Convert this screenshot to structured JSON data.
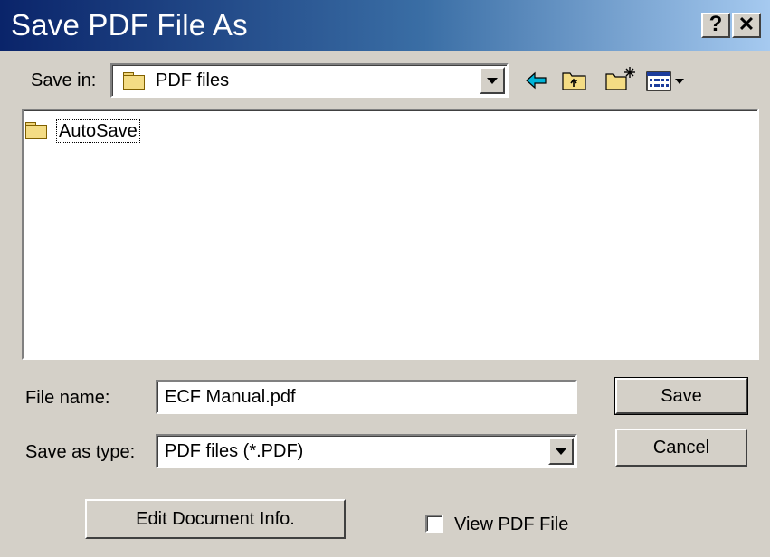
{
  "window": {
    "title": "Save PDF File As",
    "help_label": "?",
    "close_label": "✕"
  },
  "save_in": {
    "label": "Save in:",
    "value": "PDF files"
  },
  "toolbar": {
    "back_icon": "back-arrow-icon",
    "up_icon": "up-one-level-icon",
    "new_folder_icon": "new-folder-icon",
    "view_menu_icon": "view-menu-icon"
  },
  "file_list": {
    "items": [
      {
        "label": "AutoSave",
        "icon": "folder-icon"
      }
    ]
  },
  "file_name": {
    "label": "File name:",
    "value": "ECF Manual.pdf"
  },
  "save_as_type": {
    "label": "Save as type:",
    "value": "PDF files (*.PDF)"
  },
  "buttons": {
    "save_label": "Save",
    "cancel_label": "Cancel",
    "edit_info_label": "Edit Document Info."
  },
  "view_pdf": {
    "label": "View PDF File",
    "checked": false
  },
  "colors": {
    "titlebar_start": "#0a246a",
    "titlebar_end": "#a6caf0",
    "dialog_face": "#d4d0c8",
    "back_arrow": "#00b4d8",
    "folder": "#f4dc84"
  }
}
